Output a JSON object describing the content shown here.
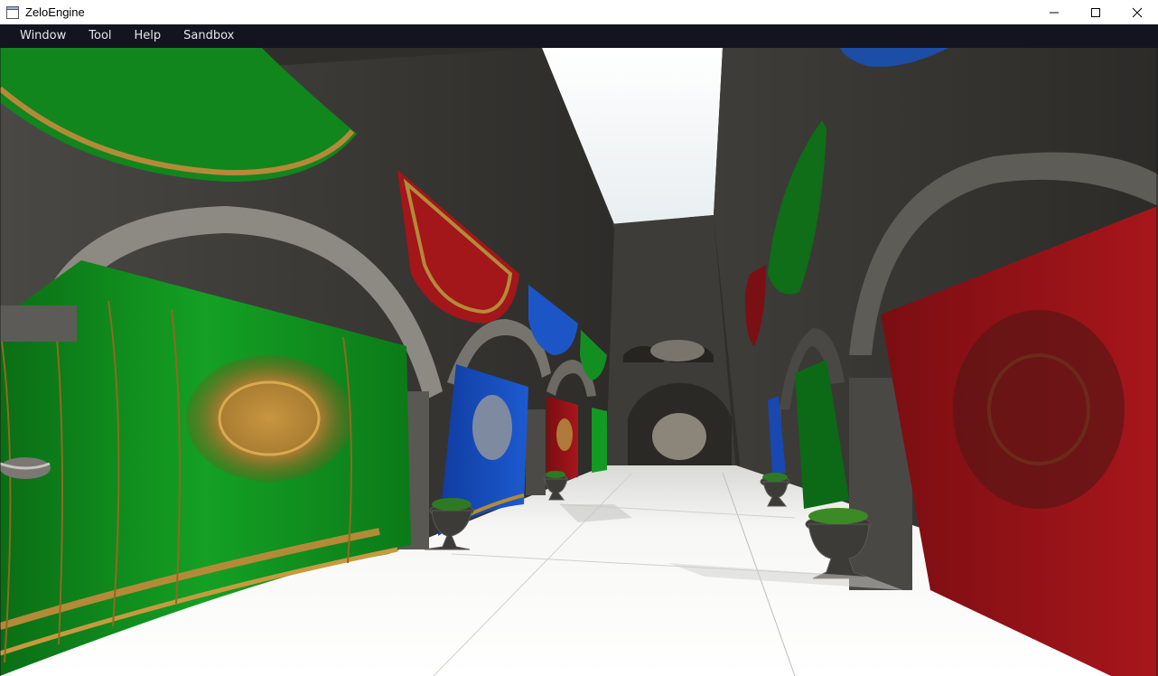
{
  "window": {
    "title": "ZeloEngine",
    "controls": [
      "minimize-icon",
      "maximize-icon",
      "close-icon"
    ]
  },
  "menu": {
    "items": [
      {
        "label": "Window"
      },
      {
        "label": "Tool"
      },
      {
        "label": "Help"
      },
      {
        "label": "Sandbox"
      }
    ]
  },
  "viewport": {
    "scene": "Sponza atrium 3D render",
    "colors": {
      "banner_green": "#0f8a1e",
      "banner_red": "#9a1418",
      "banner_blue": "#1346b8",
      "sky": "#ffffff",
      "stone": "#3a3936",
      "floor": "#f4f4f2",
      "menubar_bg": "#141420"
    }
  }
}
